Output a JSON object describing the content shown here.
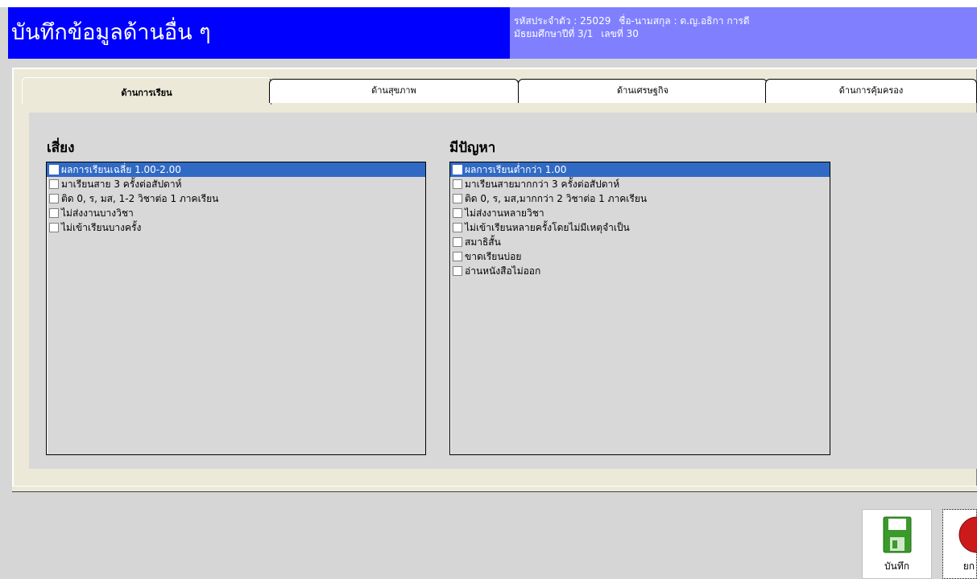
{
  "header": {
    "title": "บันทึกข้อมูลด้านอื่น ๆ",
    "student_id": "รหัสประจำตัว : 25029",
    "student_name": "ชื่อ-นามสกุล : ด.ญ.อธิกา  การดี",
    "class": "มัธยมศึกษาปีที่ 3/1",
    "number": "เลขที่  30"
  },
  "tabs": [
    {
      "label": "ด้านการเรียน",
      "active": true
    },
    {
      "label": "ด้านสุขภาพ",
      "active": false
    },
    {
      "label": "ด้านเศรษฐกิจ",
      "active": false
    },
    {
      "label": "ด้านการคุ้มครอง",
      "active": false
    }
  ],
  "risk": {
    "title": "เสี่ยง",
    "items": [
      {
        "label": "ผลการเรียนเฉลี่ย 1.00-2.00",
        "selected": true
      },
      {
        "label": "มาเรียนสาย 3 ครั้งต่อสัปดาห์",
        "selected": false
      },
      {
        "label": "ติด 0, ร, มส, 1-2 วิชาต่อ 1 ภาคเรียน",
        "selected": false
      },
      {
        "label": "ไม่ส่งงานบางวิชา",
        "selected": false
      },
      {
        "label": "ไม่เข้าเรียนบางครั้ง",
        "selected": false
      }
    ]
  },
  "problem": {
    "title": "มีปัญหา",
    "items": [
      {
        "label": "ผลการเรียนต่ำกว่า 1.00",
        "selected": true
      },
      {
        "label": "มาเรียนสายมากกว่า 3 ครั้งต่อสัปดาห์",
        "selected": false
      },
      {
        "label": "ติด 0, ร, มส,มากกว่า 2 วิชาต่อ 1 ภาคเรียน",
        "selected": false
      },
      {
        "label": "ไม่ส่งงานหลายวิชา",
        "selected": false
      },
      {
        "label": "ไม่เข้าเรียนหลายครั้งโดยไม่มีเหตุจำเป็น",
        "selected": false
      },
      {
        "label": "สมาธิสั้น",
        "selected": false
      },
      {
        "label": "ขาดเรียนบ่อย",
        "selected": false
      },
      {
        "label": "อ่านหนังสือไม่ออก",
        "selected": false
      }
    ]
  },
  "buttons": {
    "save_label": "บันทึก",
    "cancel_label": "ยก",
    "save_icon": "floppy-disk-icon",
    "cancel_icon": "cancel-icon"
  },
  "colors": {
    "title_bg": "#0000ff",
    "info_bg": "#8080ff",
    "selection": "#316ac5"
  }
}
